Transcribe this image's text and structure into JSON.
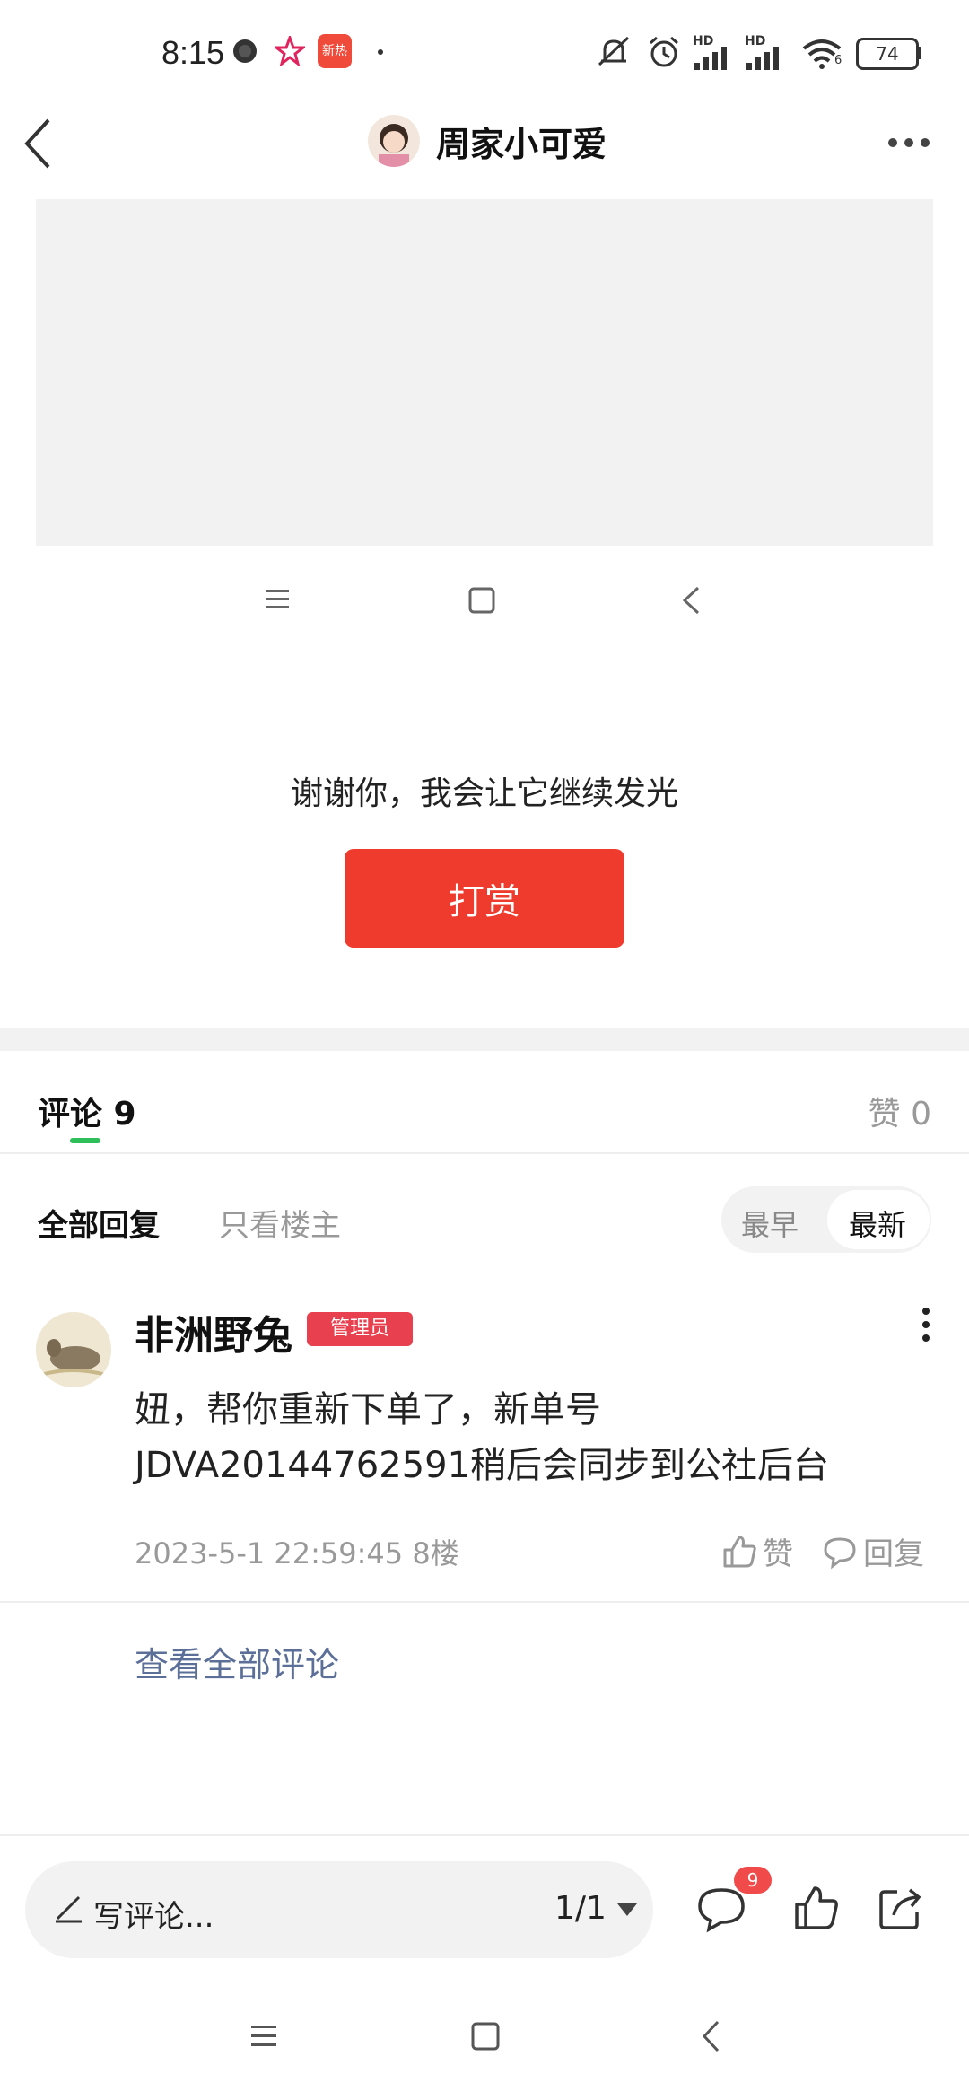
{
  "status_bar": {
    "time": "8:15",
    "app_badge": "新热",
    "battery": "74",
    "network_label_1": "HD",
    "network_label_2": "HD",
    "wifi_label": "6"
  },
  "header": {
    "title": "周家小可爱"
  },
  "post": {
    "thanks_text": "谢谢你，我会让它继续发光",
    "tip_button": "打赏"
  },
  "tabs": {
    "comments_label": "评论 9",
    "likes_label": "赞 0"
  },
  "filters": {
    "all_label": "全部回复",
    "op_only_label": "只看楼主",
    "sort_earliest": "最早",
    "sort_latest": "最新"
  },
  "comment": {
    "author": "非洲野兔",
    "badge": "管理员",
    "text": "妞，帮你重新下单了，新单号JDVA20144762591稍后会同步到公社后台",
    "meta": "2023-5-1 22:59:45  8楼",
    "like_label": "赞",
    "reply_label": "回复"
  },
  "view_all_comments": "查看全部评论",
  "bottom_bar": {
    "write_placeholder": "写评论...",
    "page_indicator": "1/1",
    "comment_count_badge": "9"
  },
  "colors": {
    "accent_red": "#ef3b2d",
    "badge_red": "#e9404f",
    "tab_indicator_green": "#2fbf5a",
    "link_blue": "#5b6f99"
  }
}
